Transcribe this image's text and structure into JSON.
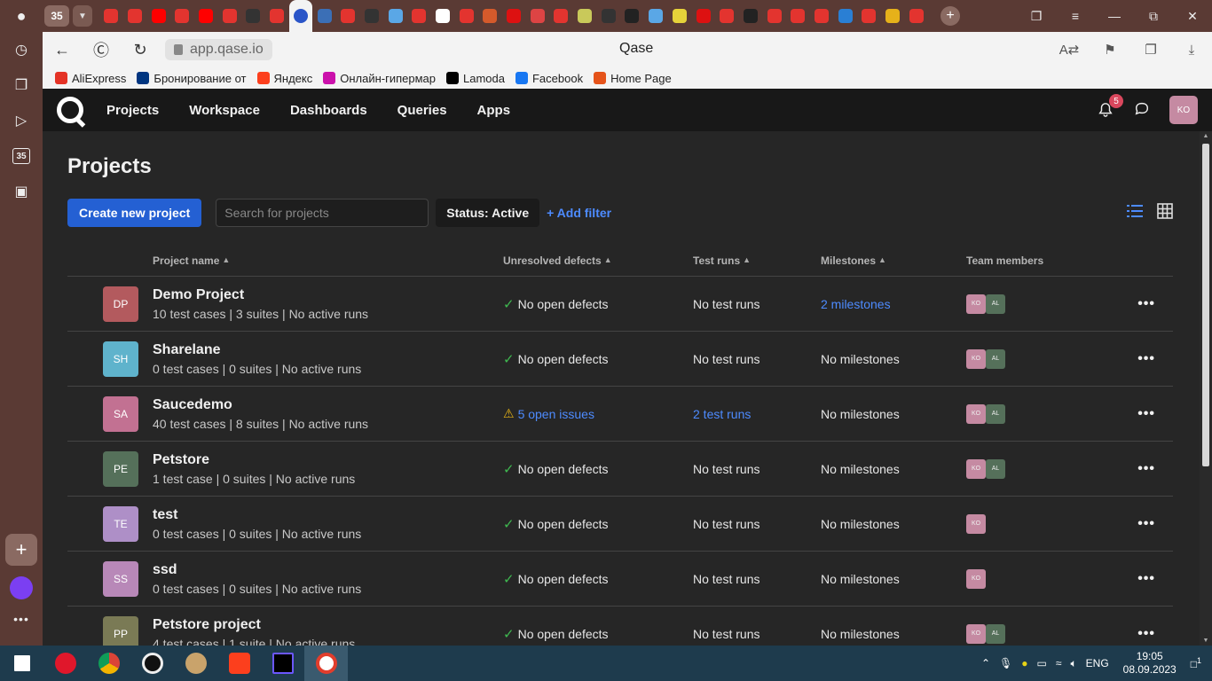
{
  "browser": {
    "tab_count": "35",
    "url": "app.qase.io",
    "page_title": "Qase",
    "bookmarks": [
      {
        "label": "AliExpress",
        "color": "#e43225"
      },
      {
        "label": "Бронирование от",
        "color": "#003580"
      },
      {
        "label": "Яндекс",
        "color": "#fc3f1d"
      },
      {
        "label": "Онлайн-гипермар",
        "color": "#cb11ab"
      },
      {
        "label": "Lamoda",
        "color": "#000000"
      },
      {
        "label": "Facebook",
        "color": "#1877f2"
      },
      {
        "label": "Home Page",
        "color": "#e5531a"
      }
    ]
  },
  "nav": {
    "links": [
      "Projects",
      "Workspace",
      "Dashboards",
      "Queries",
      "Apps"
    ],
    "notifications": "5",
    "user_initials": "KO"
  },
  "page": {
    "title": "Projects",
    "create_button": "Create new project",
    "search_placeholder": "Search for projects",
    "status_filter": "Status: Active",
    "add_filter": "+ Add filter"
  },
  "table": {
    "headers": {
      "name": "Project name",
      "defects": "Unresolved defects",
      "runs": "Test runs",
      "milestones": "Milestones",
      "team": "Team members"
    },
    "rows": [
      {
        "code": "DP",
        "color": "#b35a5e",
        "name": "Demo Project",
        "meta": "10 test cases | 3 suites | No active runs",
        "defects": "No open defects",
        "runs": "No test runs",
        "milestones": "2 milestones",
        "team": [
          "KO",
          "AL"
        ]
      },
      {
        "code": "SH",
        "color": "#5fb3cc",
        "name": "Sharelane",
        "meta": "0 test cases | 0 suites | No active runs",
        "defects": "No open defects",
        "runs": "No test runs",
        "milestones": "No milestones",
        "team": [
          "KO",
          "AL"
        ]
      },
      {
        "code": "SA",
        "color": "#c27192",
        "name": "Saucedemo",
        "meta": "40 test cases | 8 suites | No active runs",
        "defects": "5 open issues",
        "runs": "2 test runs",
        "milestones": "No milestones",
        "team": [
          "KO",
          "AL"
        ]
      },
      {
        "code": "PE",
        "color": "#55705a",
        "name": "Petstore",
        "meta": "1 test case | 0 suites | No active runs",
        "defects": "No open defects",
        "runs": "No test runs",
        "milestones": "No milestones",
        "team": [
          "KO",
          "AL"
        ]
      },
      {
        "code": "TE",
        "color": "#ae8fc7",
        "name": "test",
        "meta": "0 test cases | 0 suites | No active runs",
        "defects": "No open defects",
        "runs": "No test runs",
        "milestones": "No milestones",
        "team": [
          "KO"
        ]
      },
      {
        "code": "SS",
        "color": "#b888b8",
        "name": "ssd",
        "meta": "0 test cases | 0 suites | No active runs",
        "defects": "No open defects",
        "runs": "No test runs",
        "milestones": "No milestones",
        "team": [
          "KO"
        ]
      },
      {
        "code": "PP",
        "color": "#7a7a55",
        "name": "Petstore project",
        "meta": "4 test cases | 1 suite | No active runs",
        "defects": "No open defects",
        "runs": "No test runs",
        "milestones": "No milestones",
        "team": [
          "KO",
          "AL"
        ]
      }
    ]
  },
  "taskbar": {
    "lang": "ENG",
    "time": "19:05",
    "date": "08.09.2023",
    "notif_count": "1"
  }
}
